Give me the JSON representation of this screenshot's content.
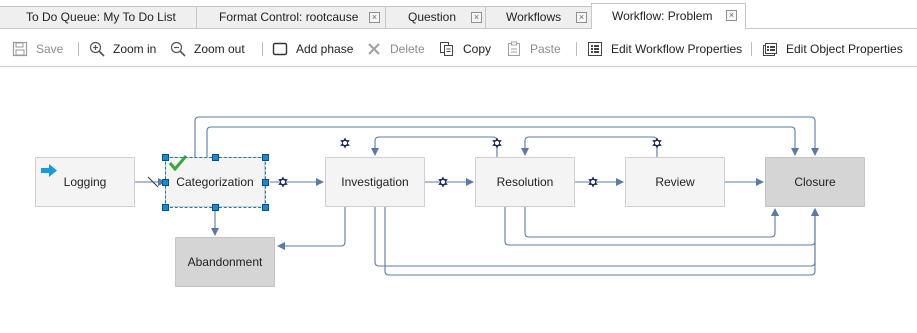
{
  "tabs": [
    {
      "label": "To Do Queue: My To Do List",
      "closable": false,
      "active": false
    },
    {
      "label": "Format Control: rootcause",
      "closable": true,
      "active": false
    },
    {
      "label": "Question",
      "closable": true,
      "active": false
    },
    {
      "label": "Workflows",
      "closable": true,
      "active": false
    },
    {
      "label": "Workflow: Problem",
      "closable": true,
      "active": true
    }
  ],
  "toolbar": {
    "save": {
      "label": "Save",
      "icon": "save-icon",
      "enabled": false
    },
    "zoom_in": {
      "label": "Zoom in",
      "icon": "zoom-in-icon",
      "enabled": true
    },
    "zoom_out": {
      "label": "Zoom out",
      "icon": "zoom-out-icon",
      "enabled": true
    },
    "add_phase": {
      "label": "Add phase",
      "icon": "add-phase-icon",
      "enabled": true
    },
    "delete": {
      "label": "Delete",
      "icon": "delete-icon",
      "enabled": false
    },
    "copy": {
      "label": "Copy",
      "icon": "copy-icon",
      "enabled": true
    },
    "paste": {
      "label": "Paste",
      "icon": "paste-icon",
      "enabled": false
    },
    "edit_workflow": {
      "label": "Edit Workflow Properties",
      "icon": "edit-workflow-icon",
      "enabled": true
    },
    "edit_object": {
      "label": "Edit Object Properties",
      "icon": "edit-object-icon",
      "enabled": true
    }
  },
  "workflow": {
    "phases": {
      "logging": {
        "label": "Logging",
        "start": true
      },
      "categorization": {
        "label": "Categorization",
        "selected": true,
        "validated": true
      },
      "investigation": {
        "label": "Investigation"
      },
      "resolution": {
        "label": "Resolution"
      },
      "review": {
        "label": "Review"
      },
      "closure": {
        "label": "Closure",
        "end": true
      },
      "abandonment": {
        "label": "Abandonment",
        "end": true
      }
    },
    "transitions": [
      {
        "from": "Logging",
        "to": "Categorization"
      },
      {
        "from": "Categorization",
        "to": "Investigation"
      },
      {
        "from": "Categorization",
        "to": "Abandonment"
      },
      {
        "from": "Categorization",
        "to": "Closure"
      },
      {
        "from": "Categorization",
        "to": "Closure"
      },
      {
        "from": "Investigation",
        "to": "Resolution"
      },
      {
        "from": "Investigation",
        "to": "Abandonment"
      },
      {
        "from": "Investigation",
        "to": "Closure"
      },
      {
        "from": "Investigation",
        "to": "Closure"
      },
      {
        "from": "Resolution",
        "to": "Investigation"
      },
      {
        "from": "Resolution",
        "to": "Review"
      },
      {
        "from": "Resolution",
        "to": "Closure"
      },
      {
        "from": "Review",
        "to": "Resolution"
      },
      {
        "from": "Review",
        "to": "Closure"
      }
    ],
    "colors": {
      "connector": "#5a7ba8",
      "gear": "#1b2a5c",
      "start_arrow": "#1a9ad6",
      "check": "#3aa53a",
      "selection": "#1a8ad4"
    }
  }
}
